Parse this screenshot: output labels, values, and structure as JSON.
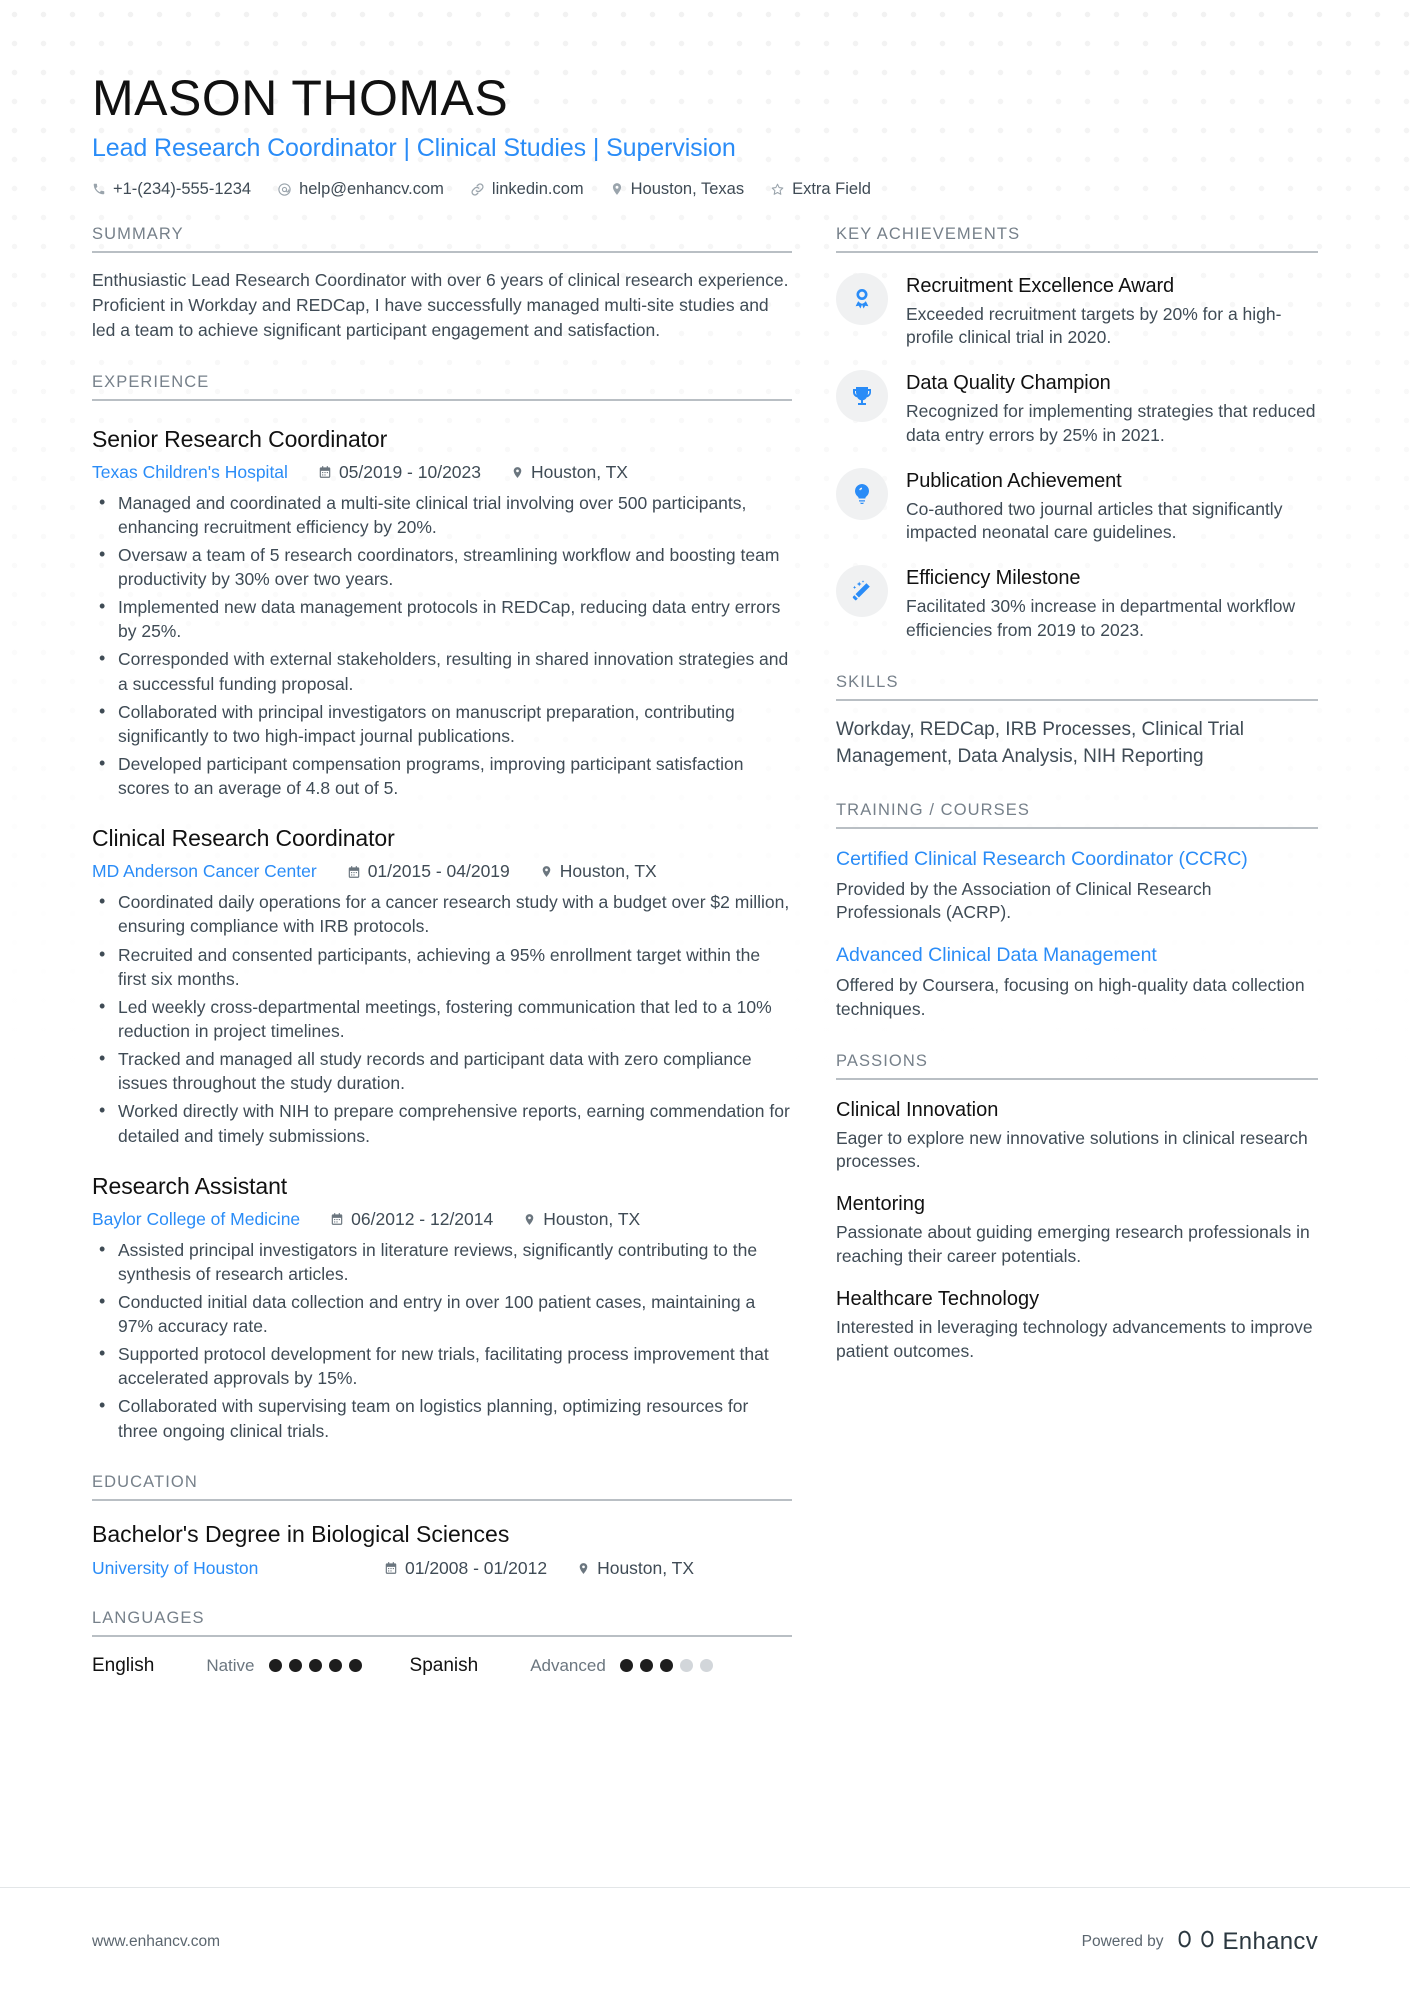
{
  "header": {
    "name": "MASON THOMAS",
    "headline": "Lead Research Coordinator | Clinical Studies | Supervision",
    "contacts": [
      {
        "icon": "phone-icon",
        "text": "+1-(234)-555-1234"
      },
      {
        "icon": "email-icon",
        "text": "help@enhancv.com"
      },
      {
        "icon": "link-icon",
        "text": "linkedin.com"
      },
      {
        "icon": "location-pin-icon",
        "text": "Houston, Texas"
      },
      {
        "icon": "star-icon",
        "text": "Extra Field"
      }
    ]
  },
  "summary": {
    "title": "SUMMARY",
    "text": "Enthusiastic Lead Research Coordinator with over 6 years of clinical research experience. Proficient in Workday and REDCap, I have successfully managed multi-site studies and led a team to achieve significant participant engagement and satisfaction."
  },
  "experience": {
    "title": "EXPERIENCE",
    "jobs": [
      {
        "role": "Senior Research Coordinator",
        "company": "Texas Children's Hospital",
        "dates": "05/2019 - 10/2023",
        "location": "Houston, TX",
        "bullets": [
          "Managed and coordinated a multi-site clinical trial involving over 500 participants, enhancing recruitment efficiency by 20%.",
          "Oversaw a team of 5 research coordinators, streamlining workflow and boosting team productivity by 30% over two years.",
          "Implemented new data management protocols in REDCap, reducing data entry errors by 25%.",
          "Corresponded with external stakeholders, resulting in shared innovation strategies and a successful funding proposal.",
          "Collaborated with principal investigators on manuscript preparation, contributing significantly to two high-impact journal publications.",
          "Developed participant compensation programs, improving participant satisfaction scores to an average of 4.8 out of 5."
        ]
      },
      {
        "role": "Clinical Research Coordinator",
        "company": "MD Anderson Cancer Center",
        "dates": "01/2015 - 04/2019",
        "location": "Houston, TX",
        "bullets": [
          "Coordinated daily operations for a cancer research study with a budget over $2 million, ensuring compliance with IRB protocols.",
          "Recruited and consented participants, achieving a 95% enrollment target within the first six months.",
          "Led weekly cross-departmental meetings, fostering communication that led to a 10% reduction in project timelines.",
          "Tracked and managed all study records and participant data with zero compliance issues throughout the study duration.",
          "Worked directly with NIH to prepare comprehensive reports, earning commendation for detailed and timely submissions."
        ]
      },
      {
        "role": "Research Assistant",
        "company": "Baylor College of Medicine",
        "dates": "06/2012 - 12/2014",
        "location": "Houston, TX",
        "bullets": [
          "Assisted principal investigators in literature reviews, significantly contributing to the synthesis of research articles.",
          "Conducted initial data collection and entry in over 100 patient cases, maintaining a 97% accuracy rate.",
          "Supported protocol development for new trials, facilitating process improvement that accelerated approvals by 15%.",
          "Collaborated with supervising team on logistics planning, optimizing resources for three ongoing clinical trials."
        ]
      }
    ]
  },
  "education": {
    "title": "EDUCATION",
    "degree": "Bachelor's Degree in Biological Sciences",
    "school": "University of Houston",
    "dates": "01/2008 - 01/2012",
    "location": "Houston, TX"
  },
  "languages": {
    "title": "LANGUAGES",
    "items": [
      {
        "name": "English",
        "level": "Native",
        "filled": 5,
        "total": 5
      },
      {
        "name": "Spanish",
        "level": "Advanced",
        "filled": 3,
        "total": 5
      }
    ]
  },
  "achievements": {
    "title": "KEY ACHIEVEMENTS",
    "items": [
      {
        "icon": "award-medal-icon",
        "heading": "Recruitment Excellence Award",
        "text": "Exceeded recruitment targets by 20% for a high-profile clinical trial in 2020."
      },
      {
        "icon": "trophy-icon",
        "heading": "Data Quality Champion",
        "text": "Recognized for implementing strategies that reduced data entry errors by 25% in 2021."
      },
      {
        "icon": "lightbulb-icon",
        "heading": "Publication Achievement",
        "text": "Co-authored two journal articles that significantly impacted neonatal care guidelines."
      },
      {
        "icon": "magic-wand-icon",
        "heading": "Efficiency Milestone",
        "text": "Facilitated 30% increase in departmental workflow efficiencies from 2019 to 2023."
      }
    ]
  },
  "skills": {
    "title": "SKILLS",
    "text": "Workday, REDCap, IRB Processes, Clinical Trial Management, Data Analysis, NIH Reporting"
  },
  "training": {
    "title": "TRAINING / COURSES",
    "items": [
      {
        "heading": "Certified Clinical Research Coordinator (CCRC)",
        "text": "Provided by the Association of Clinical Research Professionals (ACRP)."
      },
      {
        "heading": "Advanced Clinical Data Management",
        "text": "Offered by Coursera, focusing on high-quality data collection techniques."
      }
    ]
  },
  "passions": {
    "title": "PASSIONS",
    "items": [
      {
        "heading": "Clinical Innovation",
        "text": "Eager to explore new innovative solutions in clinical research processes."
      },
      {
        "heading": "Mentoring",
        "text": "Passionate about guiding emerging research professionals in reaching their career potentials."
      },
      {
        "heading": "Healthcare Technology",
        "text": "Interested in leveraging technology advancements to improve patient outcomes."
      }
    ]
  },
  "footer": {
    "url": "www.enhancv.com",
    "powered_by": "Powered by",
    "brand": "Enhancv"
  },
  "colors": {
    "accent": "#2a8cf7",
    "text": "#3f4b55",
    "heading": "#111111",
    "muted": "#76808a"
  }
}
